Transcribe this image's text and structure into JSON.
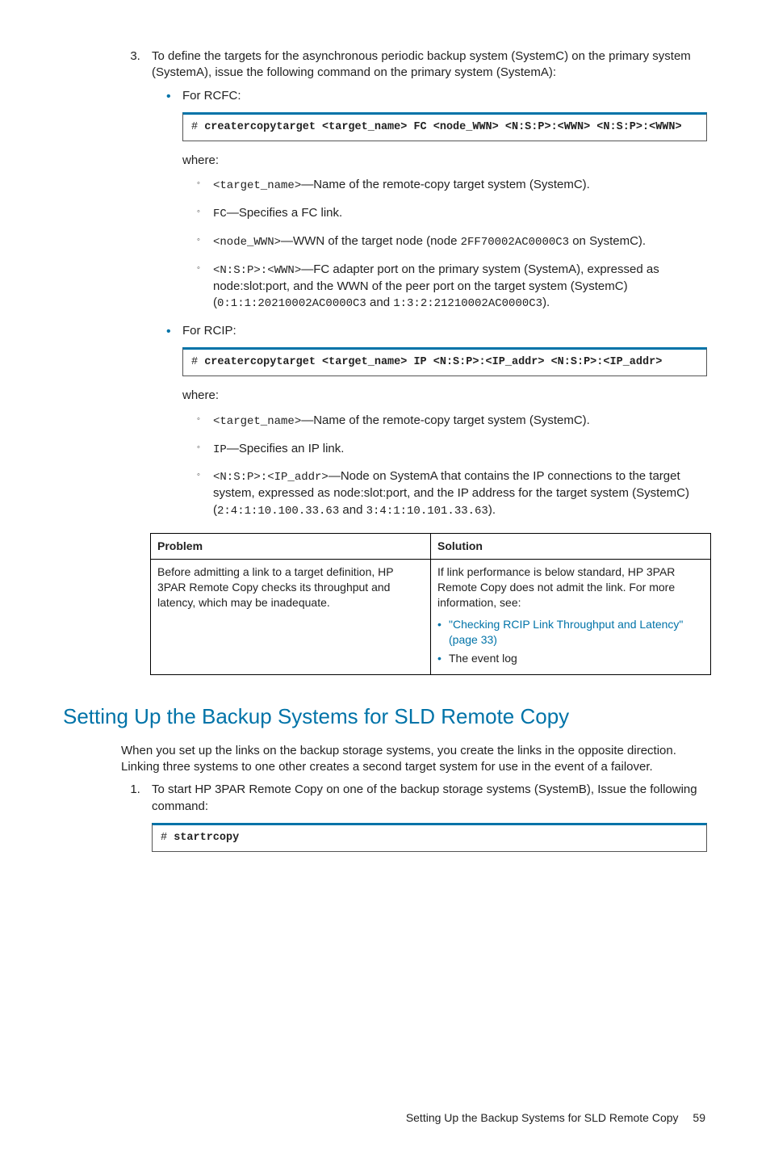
{
  "step3": {
    "text": "To define the targets for the asynchronous periodic backup system (SystemC) on the primary system (SystemA), issue the following command on the primary system (SystemA):",
    "rcfc": {
      "label": "For RCFC:",
      "cmd_prefix": "# ",
      "cmd": "creatercopytarget <target_name> FC <node_WWN> <N:S:P>:<WWN> <N:S:P>:<WWN>",
      "where": "where:",
      "items": [
        {
          "code": "<target_name>",
          "desc": "—Name of the remote-copy target system (SystemC)."
        },
        {
          "code": "FC",
          "desc": "—Specifies a FC link."
        },
        {
          "code": "<node_WWN>",
          "desc_pre": "—WWN of the target node (node ",
          "code2": "2FF70002AC0000C3",
          "desc_post": " on SystemC)."
        },
        {
          "code": "<N:S:P>:<WWN>",
          "desc_pre": "—FC adapter port on the primary system (SystemA), expressed as node:slot:port, and the WWN of the peer port on the target system (SystemC) (",
          "code2": "0:1:1:20210002AC0000C3",
          "mid": " and ",
          "code3": "1:3:2:21210002AC0000C3",
          "desc_post": ")."
        }
      ]
    },
    "rcip": {
      "label": "For RCIP:",
      "cmd_prefix": "# ",
      "cmd": "creatercopytarget <target_name> IP <N:S:P>:<IP_addr> <N:S:P>:<IP_addr>",
      "where": "where:",
      "items": [
        {
          "code": "<target_name>",
          "desc": "—Name of the remote-copy target system (SystemC)."
        },
        {
          "code": "IP",
          "desc": "—Specifies an IP link."
        },
        {
          "code": "<N:S:P>:<IP_addr>",
          "desc_pre": "—Node on SystemA that contains the IP connections to the target system, expressed as node:slot:port, and the IP address for the target system (SystemC) (",
          "code2": "2:4:1:10.100.33.63",
          "mid": " and ",
          "code3": "3:4:1:10.101.33.63",
          "desc_post": ")."
        }
      ]
    }
  },
  "table": {
    "h1": "Problem",
    "h2": "Solution",
    "problem": "Before admitting a link to a target definition, HP 3PAR Remote Copy checks its throughput and latency, which may be inadequate.",
    "sol_intro": "If link performance is below standard, HP 3PAR Remote Copy does not admit the link. For more information, see:",
    "sol_link": "\"Checking RCIP Link Throughput and Latency\" (page 33)",
    "sol_log": "The event log"
  },
  "section": {
    "title": "Setting Up the Backup Systems for SLD Remote Copy",
    "intro": "When you set up the links on the backup storage systems, you create the links in the opposite direction. Linking three systems to one other creates a second target system for use in the event of a failover.",
    "step1": "To start HP 3PAR Remote Copy on one of the backup storage systems (SystemB), Issue the following command:",
    "cmd_prefix": "# ",
    "cmd": "startrcopy"
  },
  "footer": {
    "text": "Setting Up the Backup Systems for SLD Remote Copy",
    "page": "59"
  }
}
